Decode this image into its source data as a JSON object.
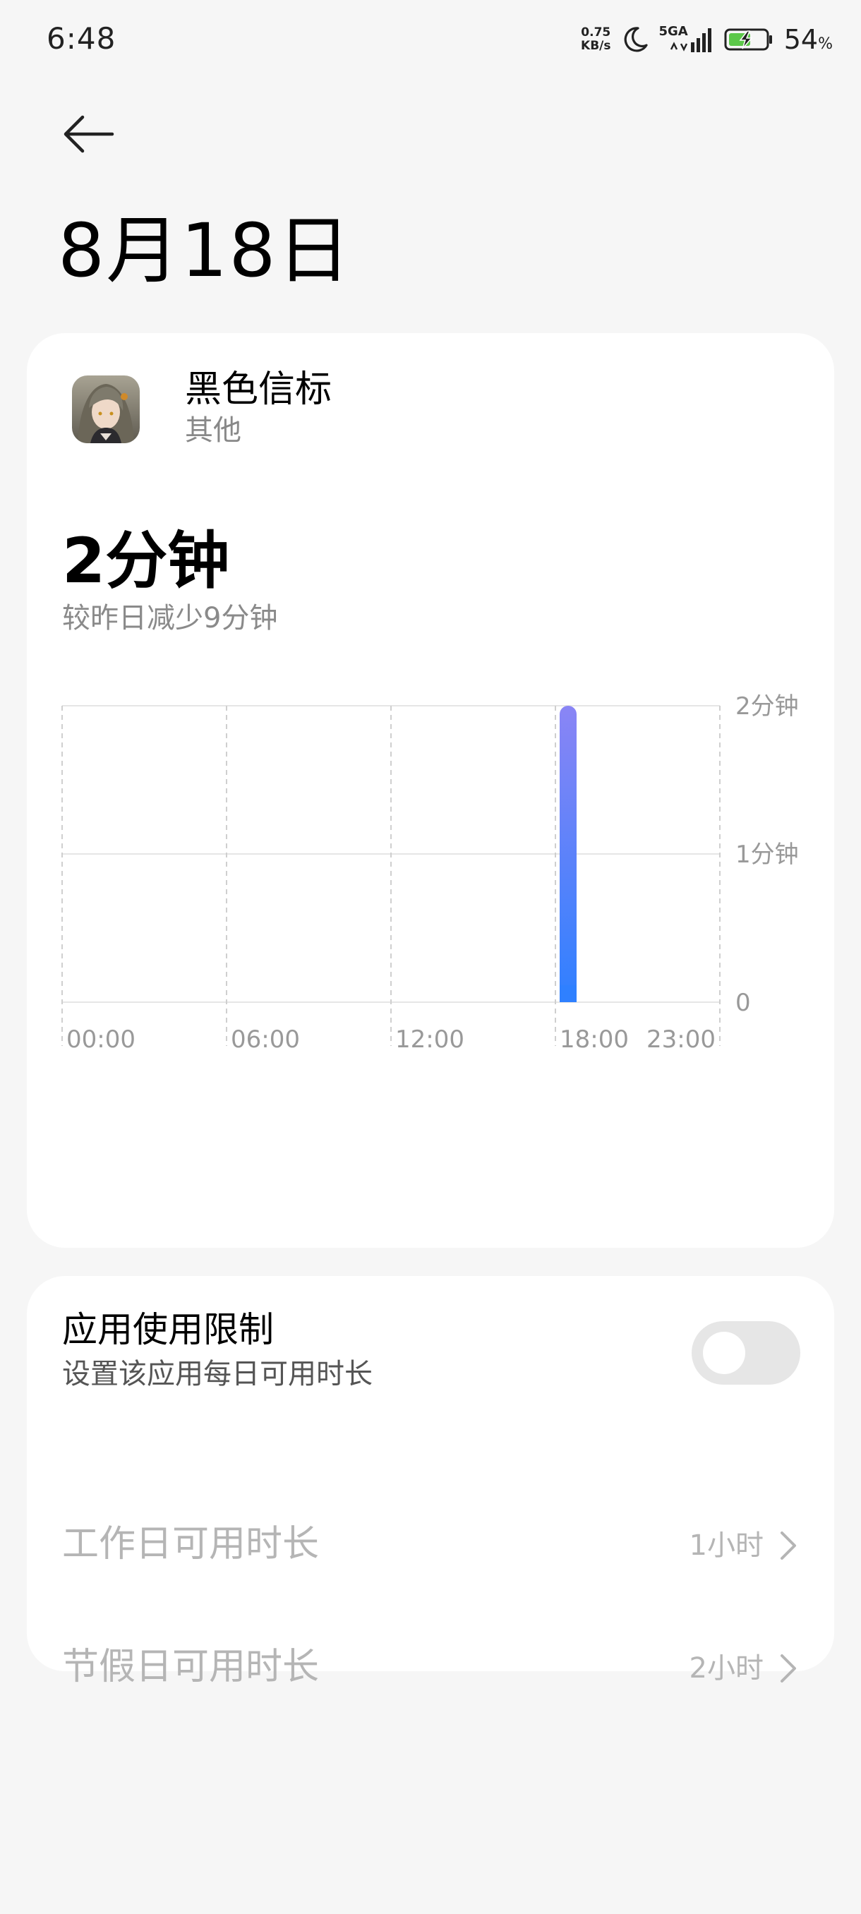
{
  "status_bar": {
    "time": "6:48",
    "net_speed_value": "0.75",
    "net_speed_unit": "KB/s",
    "network": "5GA",
    "battery_percent": "54",
    "battery_unit": "%"
  },
  "header": {
    "title": "8月18日"
  },
  "app": {
    "name": "黑色信标",
    "category": "其他",
    "usage_total": "2分钟",
    "usage_compare": "较昨日减少9分钟"
  },
  "chart_data": {
    "type": "bar",
    "x_tick_labels": [
      "00:00",
      "06:00",
      "12:00",
      "18:00",
      "23:00"
    ],
    "y_tick_labels": [
      "2分钟",
      "1分钟",
      "0"
    ],
    "ylim": [
      0,
      2
    ],
    "y_unit": "分钟",
    "bars": [
      {
        "hour": 18,
        "minutes": 2
      }
    ],
    "bar_color_top": "#8a85f5",
    "bar_color_bottom": "#2f80ff",
    "grid": true
  },
  "limits": {
    "title": "应用使用限制",
    "subtitle": "设置该应用每日可用时长",
    "toggle_on": false,
    "workday_label": "工作日可用时长",
    "workday_value": "1小时",
    "holiday_label": "节假日可用时长",
    "holiday_value": "2小时"
  }
}
